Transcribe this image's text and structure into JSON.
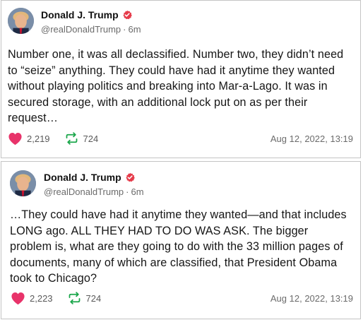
{
  "colors": {
    "heart": "#e8336a",
    "retweet": "#1aa64a",
    "verified": "#e63b4a",
    "muted": "#6b6b6b"
  },
  "posts": [
    {
      "author": "Donald J. Trump",
      "handle": "@realDonaldTrump",
      "age": "6m",
      "text": "Number one, it was all declassified. Number two, they didn’t need to “seize” anything. They could have had it anytime they wanted without playing politics and breaking into Mar-a-Lago. It was in secured storage, with an additional lock put on as per their request…",
      "likes": "2,219",
      "retruths": "724",
      "timestamp": "Aug 12, 2022, 13:19"
    },
    {
      "author": "Donald J. Trump",
      "handle": "@realDonaldTrump",
      "age": "6m",
      "text": "…They could have had it anytime they wanted—and that includes LONG ago. ALL THEY HAD TO DO WAS ASK. The bigger problem is, what are they going to do with the 33 million pages of documents, many of which are classified, that President Obama took to Chicago?",
      "likes": "2,223",
      "retruths": "724",
      "timestamp": "Aug 12, 2022, 13:19"
    }
  ]
}
